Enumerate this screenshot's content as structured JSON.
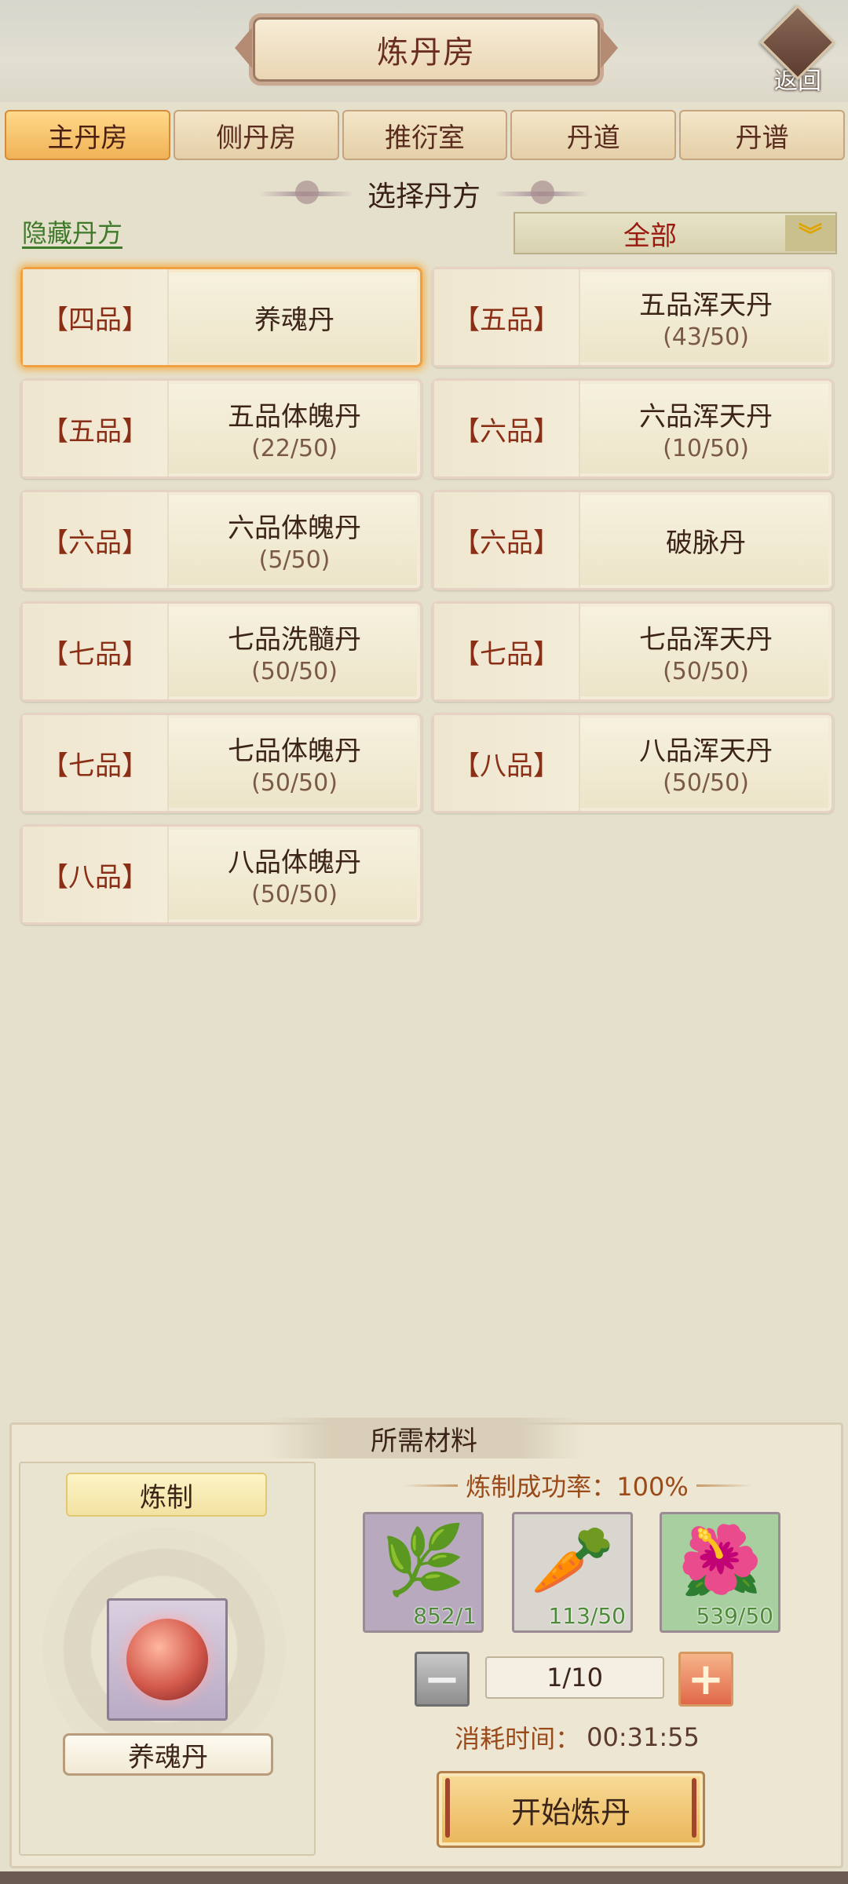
{
  "header": {
    "title": "炼丹房",
    "back_label": "返回"
  },
  "tabs": [
    {
      "label": "主丹房",
      "active": true
    },
    {
      "label": "侧丹房",
      "active": false
    },
    {
      "label": "推衍室",
      "active": false
    },
    {
      "label": "丹道",
      "active": false
    },
    {
      "label": "丹谱",
      "active": false
    }
  ],
  "select_section": {
    "title": "选择丹方",
    "hide_link": "隐藏丹方",
    "filter_value": "全部"
  },
  "recipes": [
    {
      "grade": "【四品】",
      "name": "养魂丹",
      "count": "",
      "selected": true
    },
    {
      "grade": "【五品】",
      "name": "五品浑天丹",
      "count": "(43/50)"
    },
    {
      "grade": "【五品】",
      "name": "五品体魄丹",
      "count": "(22/50)"
    },
    {
      "grade": "【六品】",
      "name": "六品浑天丹",
      "count": "(10/50)"
    },
    {
      "grade": "【六品】",
      "name": "六品体魄丹",
      "count": "(5/50)"
    },
    {
      "grade": "【六品】",
      "name": "破脉丹",
      "count": ""
    },
    {
      "grade": "【七品】",
      "name": "七品洗髓丹",
      "count": "(50/50)"
    },
    {
      "grade": "【七品】",
      "name": "七品浑天丹",
      "count": "(50/50)"
    },
    {
      "grade": "【七品】",
      "name": "七品体魄丹",
      "count": "(50/50)"
    },
    {
      "grade": "【八品】",
      "name": "八品浑天丹",
      "count": "(50/50)"
    },
    {
      "grade": "【八品】",
      "name": "八品体魄丹",
      "count": "(50/50)"
    }
  ],
  "materials_panel": {
    "title": "所需材料",
    "craft_label": "炼制",
    "selected_pill": "养魂丹",
    "success_rate": "炼制成功率：100%",
    "materials": [
      {
        "icon": "herb-cluster-icon",
        "qty": "852/1",
        "color": "#b8a9be"
      },
      {
        "icon": "ginseng-root-icon",
        "qty": "113/50",
        "color": "#d9d6cf"
      },
      {
        "icon": "purple-flower-icon",
        "qty": "539/50",
        "color": "#a8cfa0"
      }
    ],
    "quantity": "1/10",
    "time_label": "消耗时间：",
    "time_value": "00:31:55",
    "start_label": "开始炼丹"
  }
}
